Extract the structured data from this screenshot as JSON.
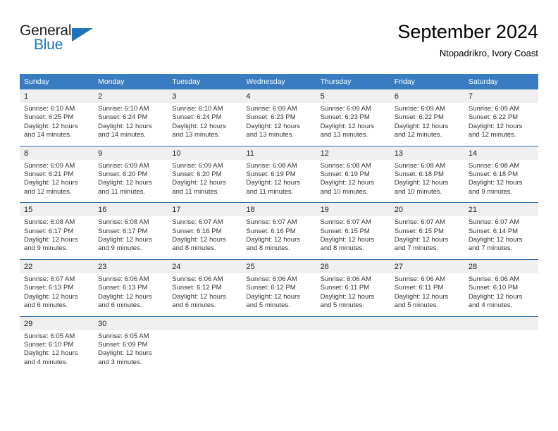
{
  "brand": {
    "word_one": "General",
    "word_two": "Blue",
    "logo_icon": "triangle-logo-icon",
    "accent_color": "#1b75bb"
  },
  "header": {
    "title": "September 2024",
    "subtitle": "Ntopadrikro, Ivory Coast"
  },
  "calendar": {
    "header_bg": "#3a7cc1",
    "daynum_bg": "#efefef",
    "separator_color": "#2e6da8",
    "weekday_headers": [
      "Sunday",
      "Monday",
      "Tuesday",
      "Wednesday",
      "Thursday",
      "Friday",
      "Saturday"
    ],
    "weeks": [
      {
        "days": [
          {
            "num": "1",
            "sunrise": "Sunrise: 6:10 AM",
            "sunset": "Sunset: 6:25 PM",
            "daylight1": "Daylight: 12 hours",
            "daylight2": "and 14 minutes."
          },
          {
            "num": "2",
            "sunrise": "Sunrise: 6:10 AM",
            "sunset": "Sunset: 6:24 PM",
            "daylight1": "Daylight: 12 hours",
            "daylight2": "and 14 minutes."
          },
          {
            "num": "3",
            "sunrise": "Sunrise: 6:10 AM",
            "sunset": "Sunset: 6:24 PM",
            "daylight1": "Daylight: 12 hours",
            "daylight2": "and 13 minutes."
          },
          {
            "num": "4",
            "sunrise": "Sunrise: 6:09 AM",
            "sunset": "Sunset: 6:23 PM",
            "daylight1": "Daylight: 12 hours",
            "daylight2": "and 13 minutes."
          },
          {
            "num": "5",
            "sunrise": "Sunrise: 6:09 AM",
            "sunset": "Sunset: 6:23 PM",
            "daylight1": "Daylight: 12 hours",
            "daylight2": "and 13 minutes."
          },
          {
            "num": "6",
            "sunrise": "Sunrise: 6:09 AM",
            "sunset": "Sunset: 6:22 PM",
            "daylight1": "Daylight: 12 hours",
            "daylight2": "and 12 minutes."
          },
          {
            "num": "7",
            "sunrise": "Sunrise: 6:09 AM",
            "sunset": "Sunset: 6:22 PM",
            "daylight1": "Daylight: 12 hours",
            "daylight2": "and 12 minutes."
          }
        ]
      },
      {
        "days": [
          {
            "num": "8",
            "sunrise": "Sunrise: 6:09 AM",
            "sunset": "Sunset: 6:21 PM",
            "daylight1": "Daylight: 12 hours",
            "daylight2": "and 12 minutes."
          },
          {
            "num": "9",
            "sunrise": "Sunrise: 6:09 AM",
            "sunset": "Sunset: 6:20 PM",
            "daylight1": "Daylight: 12 hours",
            "daylight2": "and 11 minutes."
          },
          {
            "num": "10",
            "sunrise": "Sunrise: 6:09 AM",
            "sunset": "Sunset: 6:20 PM",
            "daylight1": "Daylight: 12 hours",
            "daylight2": "and 11 minutes."
          },
          {
            "num": "11",
            "sunrise": "Sunrise: 6:08 AM",
            "sunset": "Sunset: 6:19 PM",
            "daylight1": "Daylight: 12 hours",
            "daylight2": "and 11 minutes."
          },
          {
            "num": "12",
            "sunrise": "Sunrise: 6:08 AM",
            "sunset": "Sunset: 6:19 PM",
            "daylight1": "Daylight: 12 hours",
            "daylight2": "and 10 minutes."
          },
          {
            "num": "13",
            "sunrise": "Sunrise: 6:08 AM",
            "sunset": "Sunset: 6:18 PM",
            "daylight1": "Daylight: 12 hours",
            "daylight2": "and 10 minutes."
          },
          {
            "num": "14",
            "sunrise": "Sunrise: 6:08 AM",
            "sunset": "Sunset: 6:18 PM",
            "daylight1": "Daylight: 12 hours",
            "daylight2": "and 9 minutes."
          }
        ]
      },
      {
        "days": [
          {
            "num": "15",
            "sunrise": "Sunrise: 6:08 AM",
            "sunset": "Sunset: 6:17 PM",
            "daylight1": "Daylight: 12 hours",
            "daylight2": "and 9 minutes."
          },
          {
            "num": "16",
            "sunrise": "Sunrise: 6:08 AM",
            "sunset": "Sunset: 6:17 PM",
            "daylight1": "Daylight: 12 hours",
            "daylight2": "and 9 minutes."
          },
          {
            "num": "17",
            "sunrise": "Sunrise: 6:07 AM",
            "sunset": "Sunset: 6:16 PM",
            "daylight1": "Daylight: 12 hours",
            "daylight2": "and 8 minutes."
          },
          {
            "num": "18",
            "sunrise": "Sunrise: 6:07 AM",
            "sunset": "Sunset: 6:16 PM",
            "daylight1": "Daylight: 12 hours",
            "daylight2": "and 8 minutes."
          },
          {
            "num": "19",
            "sunrise": "Sunrise: 6:07 AM",
            "sunset": "Sunset: 6:15 PM",
            "daylight1": "Daylight: 12 hours",
            "daylight2": "and 8 minutes."
          },
          {
            "num": "20",
            "sunrise": "Sunrise: 6:07 AM",
            "sunset": "Sunset: 6:15 PM",
            "daylight1": "Daylight: 12 hours",
            "daylight2": "and 7 minutes."
          },
          {
            "num": "21",
            "sunrise": "Sunrise: 6:07 AM",
            "sunset": "Sunset: 6:14 PM",
            "daylight1": "Daylight: 12 hours",
            "daylight2": "and 7 minutes."
          }
        ]
      },
      {
        "days": [
          {
            "num": "22",
            "sunrise": "Sunrise: 6:07 AM",
            "sunset": "Sunset: 6:13 PM",
            "daylight1": "Daylight: 12 hours",
            "daylight2": "and 6 minutes."
          },
          {
            "num": "23",
            "sunrise": "Sunrise: 6:06 AM",
            "sunset": "Sunset: 6:13 PM",
            "daylight1": "Daylight: 12 hours",
            "daylight2": "and 6 minutes."
          },
          {
            "num": "24",
            "sunrise": "Sunrise: 6:06 AM",
            "sunset": "Sunset: 6:12 PM",
            "daylight1": "Daylight: 12 hours",
            "daylight2": "and 6 minutes."
          },
          {
            "num": "25",
            "sunrise": "Sunrise: 6:06 AM",
            "sunset": "Sunset: 6:12 PM",
            "daylight1": "Daylight: 12 hours",
            "daylight2": "and 5 minutes."
          },
          {
            "num": "26",
            "sunrise": "Sunrise: 6:06 AM",
            "sunset": "Sunset: 6:11 PM",
            "daylight1": "Daylight: 12 hours",
            "daylight2": "and 5 minutes."
          },
          {
            "num": "27",
            "sunrise": "Sunrise: 6:06 AM",
            "sunset": "Sunset: 6:11 PM",
            "daylight1": "Daylight: 12 hours",
            "daylight2": "and 5 minutes."
          },
          {
            "num": "28",
            "sunrise": "Sunrise: 6:06 AM",
            "sunset": "Sunset: 6:10 PM",
            "daylight1": "Daylight: 12 hours",
            "daylight2": "and 4 minutes."
          }
        ]
      },
      {
        "days": [
          {
            "num": "29",
            "sunrise": "Sunrise: 6:05 AM",
            "sunset": "Sunset: 6:10 PM",
            "daylight1": "Daylight: 12 hours",
            "daylight2": "and 4 minutes."
          },
          {
            "num": "30",
            "sunrise": "Sunrise: 6:05 AM",
            "sunset": "Sunset: 6:09 PM",
            "daylight1": "Daylight: 12 hours",
            "daylight2": "and 3 minutes."
          },
          {
            "num": "",
            "sunrise": "",
            "sunset": "",
            "daylight1": "",
            "daylight2": ""
          },
          {
            "num": "",
            "sunrise": "",
            "sunset": "",
            "daylight1": "",
            "daylight2": ""
          },
          {
            "num": "",
            "sunrise": "",
            "sunset": "",
            "daylight1": "",
            "daylight2": ""
          },
          {
            "num": "",
            "sunrise": "",
            "sunset": "",
            "daylight1": "",
            "daylight2": ""
          },
          {
            "num": "",
            "sunrise": "",
            "sunset": "",
            "daylight1": "",
            "daylight2": ""
          }
        ]
      }
    ]
  }
}
